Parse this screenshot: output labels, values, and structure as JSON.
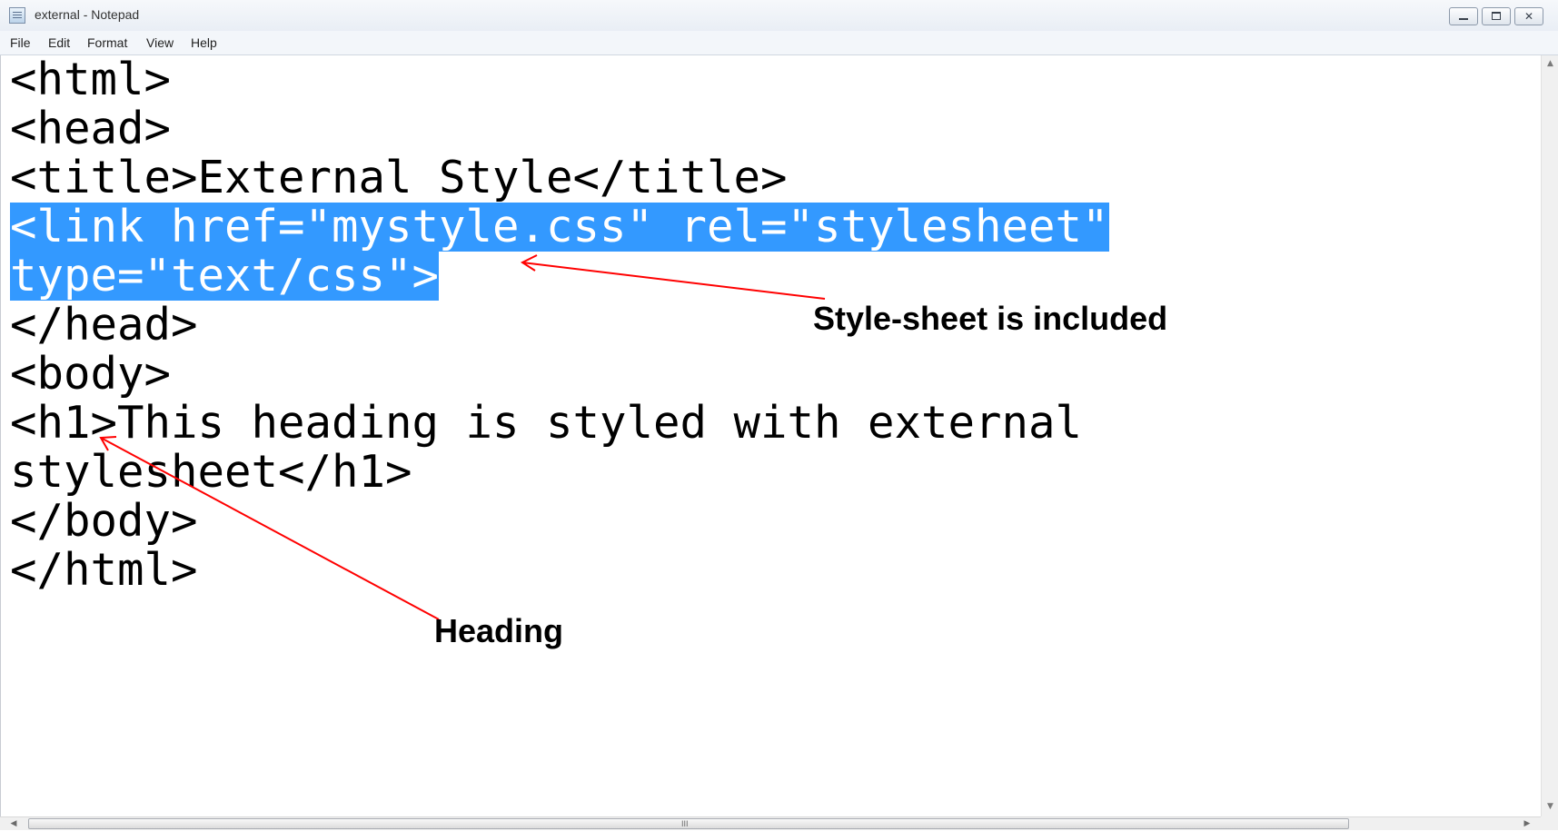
{
  "window": {
    "title": "external - Notepad"
  },
  "menu": [
    {
      "label": "File"
    },
    {
      "label": "Edit"
    },
    {
      "label": "Format"
    },
    {
      "label": "View"
    },
    {
      "label": "Help"
    }
  ],
  "window_controls": {
    "close_glyph": "✕"
  },
  "editor": {
    "lines": [
      {
        "text": "<html>"
      },
      {
        "text": "<head>"
      },
      {
        "text": "<title>External Style</title>"
      },
      {
        "text": "<link href=\"mystyle.css\" rel=\"stylesheet\"",
        "selected": true
      },
      {
        "text": "type=\"text/css\">",
        "selected": true
      },
      {
        "text": "</head>"
      },
      {
        "text": "<body>"
      },
      {
        "text": "<h1>This heading is styled with external"
      },
      {
        "text": "stylesheet</h1>"
      },
      {
        "text": "</body>"
      },
      {
        "text": "</html>"
      }
    ]
  },
  "annotations": {
    "stylesheet_label": "Style-sheet is included",
    "heading_label": "Heading",
    "arrow_color": "#ff0000"
  },
  "scrollbar": {
    "grip": "III",
    "left_arrow": "◀",
    "right_arrow": "▶",
    "up_arrow": "▲",
    "down_arrow": "▼"
  },
  "colors": {
    "selection": "#3399ff",
    "selection_text": "#ffffff"
  }
}
